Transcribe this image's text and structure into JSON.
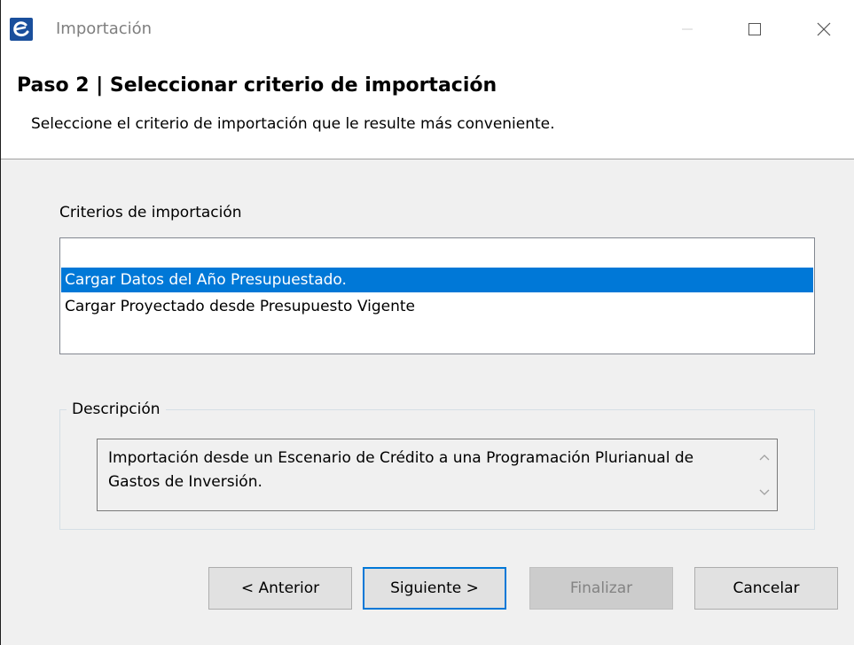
{
  "window": {
    "title": "Importación"
  },
  "header": {
    "step_title": "Paso 2 | Seleccionar criterio de importación",
    "step_description": "Seleccione el criterio de importación que le resulte más conveniente."
  },
  "criteria": {
    "label": "Criterios de importación",
    "items": [
      {
        "label": "Cargar Datos del Año Presupuestado.",
        "selected": true
      },
      {
        "label": "Cargar Proyectado desde Presupuesto Vigente",
        "selected": false
      }
    ]
  },
  "description": {
    "legend": "Descripción",
    "text": "Importación desde un Escenario de Crédito a una Programación Plurianual de Gastos de Inversión."
  },
  "buttons": {
    "previous": "< Anterior",
    "next": "Siguiente >",
    "finish": "Finalizar",
    "cancel": "Cancelar"
  },
  "colors": {
    "selection": "#0078d7",
    "window_bg": "#f0f0f0",
    "disabled_text": "#838383"
  }
}
